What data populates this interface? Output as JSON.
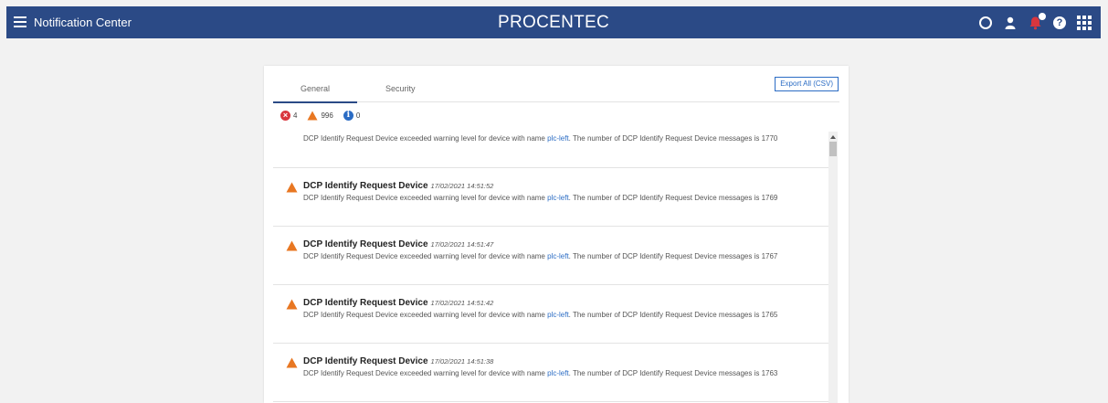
{
  "header": {
    "app_title": "Notification Center",
    "brand": "PROCENTEC",
    "icons": [
      "menu-icon",
      "status-ring-icon",
      "user-icon",
      "bell-icon",
      "help-icon",
      "apps-grid-icon"
    ]
  },
  "tabs": [
    {
      "label": "General",
      "active": true
    },
    {
      "label": "Security",
      "active": false
    }
  ],
  "export_button": "Export All (CSV)",
  "counts": {
    "errors": "4",
    "warnings": "996",
    "info": "0"
  },
  "colors": {
    "header_bg": "#2b4a86",
    "error": "#d9363e",
    "warning": "#e87722",
    "info": "#2b6cc4",
    "link": "#2b6cc4"
  },
  "notifications": [
    {
      "title": "",
      "time": "",
      "msg_before": "DCP Identify Request Device exceeded warning level for device with name ",
      "device": "plc-left",
      "msg_after": ". The number of DCP Identify Request Device messages is 1770"
    },
    {
      "title": "DCP Identify Request Device",
      "time": "17/02/2021 14:51:52",
      "msg_before": "DCP Identify Request Device exceeded warning level for device with name ",
      "device": "plc-left",
      "msg_after": ". The number of DCP Identify Request Device messages is 1769"
    },
    {
      "title": "DCP Identify Request Device",
      "time": "17/02/2021 14:51:47",
      "msg_before": "DCP Identify Request Device exceeded warning level for device with name ",
      "device": "plc-left",
      "msg_after": ". The number of DCP Identify Request Device messages is 1767"
    },
    {
      "title": "DCP Identify Request Device",
      "time": "17/02/2021 14:51:42",
      "msg_before": "DCP Identify Request Device exceeded warning level for device with name ",
      "device": "plc-left",
      "msg_after": ". The number of DCP Identify Request Device messages is 1765"
    },
    {
      "title": "DCP Identify Request Device",
      "time": "17/02/2021 14:51:38",
      "msg_before": "DCP Identify Request Device exceeded warning level for device with name ",
      "device": "plc-left",
      "msg_after": ". The number of DCP Identify Request Device messages is 1763"
    }
  ]
}
